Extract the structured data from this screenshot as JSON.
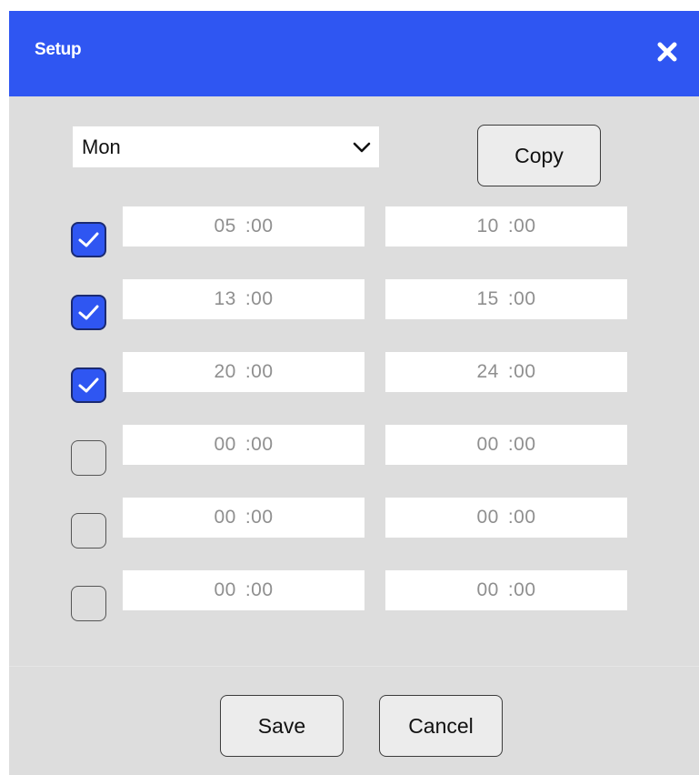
{
  "dialog": {
    "title": "Setup",
    "close_icon": "close-icon",
    "colors": {
      "titlebar": "#2f56f2",
      "body": "#dddddd",
      "checkbox_checked": "#2f56f2"
    }
  },
  "day_select": {
    "selected": "Mon",
    "icon": "chevron-down-icon"
  },
  "buttons": {
    "copy": "Copy",
    "save": "Save",
    "cancel": "Cancel"
  },
  "time_slots": [
    {
      "enabled": true,
      "start_hour": "05",
      "start_min": ":00",
      "end_hour": "10",
      "end_min": ":00"
    },
    {
      "enabled": true,
      "start_hour": "13",
      "start_min": ":00",
      "end_hour": "15",
      "end_min": ":00"
    },
    {
      "enabled": true,
      "start_hour": "20",
      "start_min": ":00",
      "end_hour": "24",
      "end_min": ":00"
    },
    {
      "enabled": false,
      "start_hour": "00",
      "start_min": ":00",
      "end_hour": "00",
      "end_min": ":00"
    },
    {
      "enabled": false,
      "start_hour": "00",
      "start_min": ":00",
      "end_hour": "00",
      "end_min": ":00"
    },
    {
      "enabled": false,
      "start_hour": "00",
      "start_min": ":00",
      "end_hour": "00",
      "end_min": ":00"
    }
  ]
}
